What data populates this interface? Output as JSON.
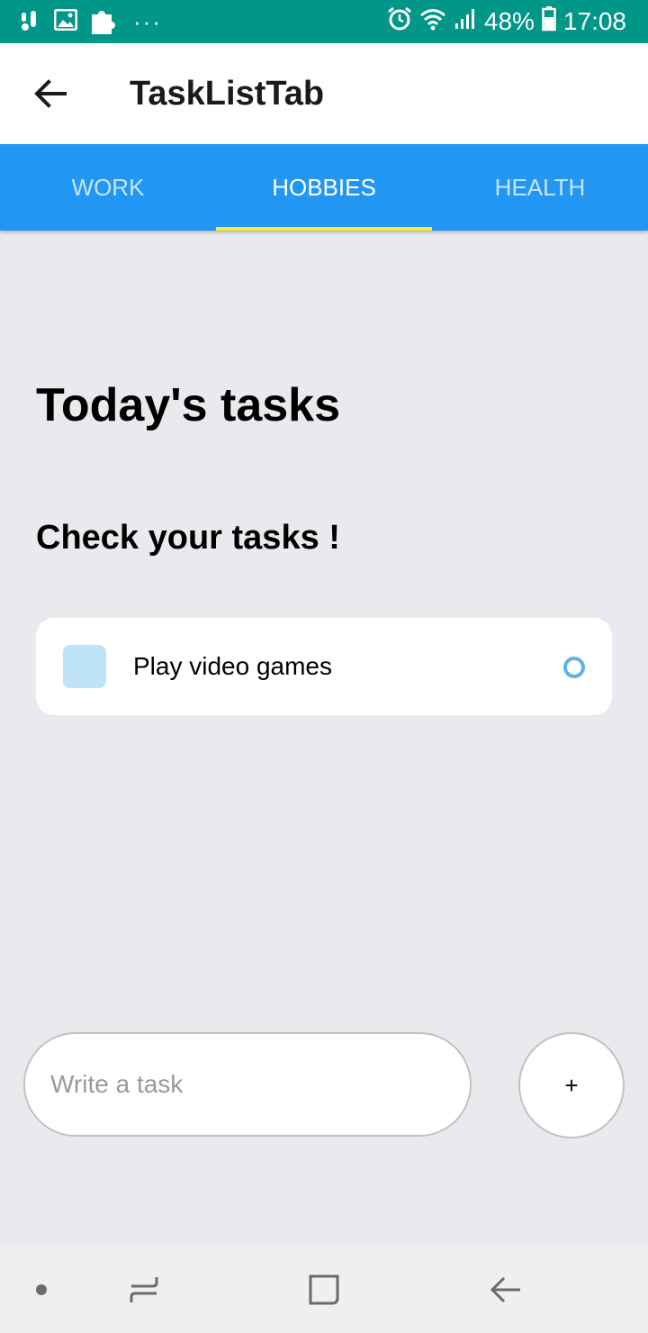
{
  "status_bar": {
    "battery": "48%",
    "time": "17:08",
    "overflow": "···",
    "background_color": "#009688"
  },
  "app_bar": {
    "title": "TaskListTab",
    "back_icon": "arrow-left-icon"
  },
  "tabs": [
    {
      "label": "WORK",
      "active": false
    },
    {
      "label": "HOBBIES",
      "active": true
    },
    {
      "label": "HEALTH",
      "active": false
    }
  ],
  "tab_bar_color": "#2196F3",
  "tab_indicator_color": "#F3EE3F",
  "content": {
    "heading": "Today's tasks",
    "subheading": "Check your tasks !",
    "tasks": [
      {
        "label": "Play video games",
        "done": false
      }
    ]
  },
  "input": {
    "placeholder": "Write a task",
    "value": ""
  },
  "add_button": {
    "label": "+"
  },
  "nav_bar": {
    "items": [
      "dot-icon",
      "recent-apps-icon",
      "home-icon",
      "back-icon"
    ]
  }
}
